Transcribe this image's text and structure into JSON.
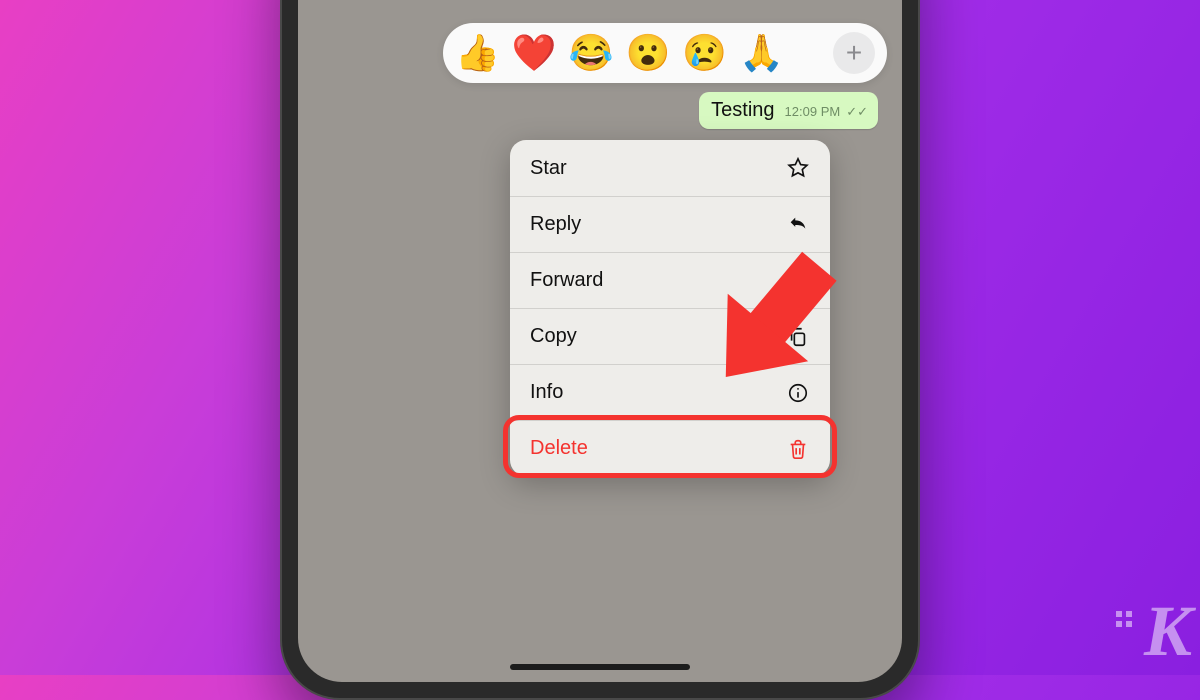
{
  "reactions": {
    "emojis": [
      "👍",
      "❤️",
      "😂",
      "😮",
      "😢",
      "🙏"
    ],
    "add_label": "+"
  },
  "message": {
    "text": "Testing",
    "time": "12:09 PM",
    "checks": "✓✓"
  },
  "menu": {
    "star": "Star",
    "reply": "Reply",
    "forward": "Forward",
    "copy": "Copy",
    "info": "Info",
    "delete": "Delete"
  },
  "watermark": "K"
}
